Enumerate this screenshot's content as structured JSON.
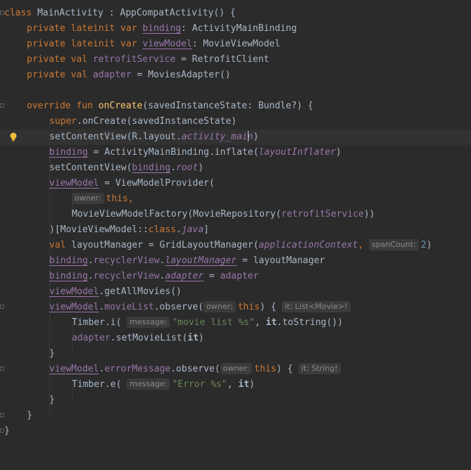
{
  "editor": {
    "line1": {
      "kw": "class",
      "name": " MainActivity : AppCompatActivity() {"
    },
    "line2": {
      "kw": "private lateinit var",
      "prop": "binding",
      "rest": ": ActivityMainBinding"
    },
    "line3": {
      "kw": "private lateinit var",
      "prop": "viewModel",
      "rest": ": MovieViewModel"
    },
    "line4": {
      "kw": "private val",
      "prop": "retrofitService",
      "rest": " = RetrofitClient"
    },
    "line5": {
      "kw": "private val",
      "prop": "adapter",
      "rest": " = MoviesAdapter()"
    },
    "line7": {
      "kw": "override fun",
      "fn": "onCreate",
      "rest": "(savedInstanceState: Bundle?) {"
    },
    "line8": {
      "kw": "super",
      "rest": ".onCreate(savedInstanceState)"
    },
    "line9": {
      "a": "setContentView(R.layout.",
      "b": "activity_mai",
      "c": "n",
      "d": ")"
    },
    "line10": {
      "prop": "binding",
      "a": " = ActivityMainBinding.inflate(",
      "ext": "layoutInflater",
      "b": ")"
    },
    "line11": {
      "a": "setContentView(",
      "prop": "binding",
      "b": ".",
      "ext": "root",
      "c": ")"
    },
    "line12": {
      "prop": "viewModel",
      "a": " = ViewModelProvider("
    },
    "line13": {
      "hint": "owner:",
      "kw": "this,"
    },
    "line14": {
      "a": "MovieViewModelFactory(MovieRepository(",
      "prop": "retrofitService",
      "b": "))"
    },
    "line15": {
      "a": ")[MovieViewModel::",
      "kw": "class",
      "b": ".",
      "ext": "java",
      "c": "]"
    },
    "line16": {
      "kw": "val",
      "a": " layoutManager = GridLayoutManager(",
      "ext": "applicationContext",
      "b": ",",
      "hint": "spanCount:",
      "num": "2",
      "c": ")"
    },
    "line17": {
      "prop1": "binding",
      "a": ".",
      "prop2": "recyclerView",
      "b": ".",
      "ext": "layoutManager",
      "c": " = layoutManager"
    },
    "line18": {
      "prop1": "binding",
      "a": ".",
      "prop2": "recyclerView",
      "b": ".",
      "ext": "adapter",
      "c": " = ",
      "prop3": "adapter"
    },
    "line19": {
      "prop": "viewModel",
      "a": ".getAllMovies()"
    },
    "line20": {
      "prop1": "viewModel",
      "a": ".",
      "prop2": "movieList",
      "b": ".observe(",
      "hint": "owner:",
      "kw": "this",
      "c": ") {",
      "hint2": "it: List<Movie>!"
    },
    "line21": {
      "a": "Timber.i(",
      "hint": "message:",
      "str": "\"movie list %s\"",
      "b": ", ",
      "it": "it",
      "c": ".toString())"
    },
    "line22": {
      "prop": "adapter",
      "a": ".setMovieList(",
      "it": "it",
      "b": ")"
    },
    "line23": {
      "a": "}"
    },
    "line24": {
      "prop1": "viewModel",
      "a": ".",
      "prop2": "errorMessage",
      "b": ".observe(",
      "hint": "owner:",
      "kw": "this",
      "c": ") {",
      "hint2": "it: String!"
    },
    "line25": {
      "a": "Timber.e(",
      "hint": "message:",
      "str": "\"Error %s\"",
      "b": ", ",
      "it": "it",
      "c": ")"
    },
    "line26": {
      "a": "}"
    },
    "line27": {
      "a": "}"
    },
    "line28": {
      "a": "}"
    }
  },
  "colors": {
    "background": "#2b2b2b",
    "keyword": "#cc7832",
    "function": "#ffc66d",
    "property": "#9876aa",
    "string": "#6a8759",
    "number": "#6897bb",
    "text": "#a9b7c6"
  },
  "icons": {
    "gutter_bulb": "lightbulb-icon",
    "fold_marker": "fold-icon"
  }
}
